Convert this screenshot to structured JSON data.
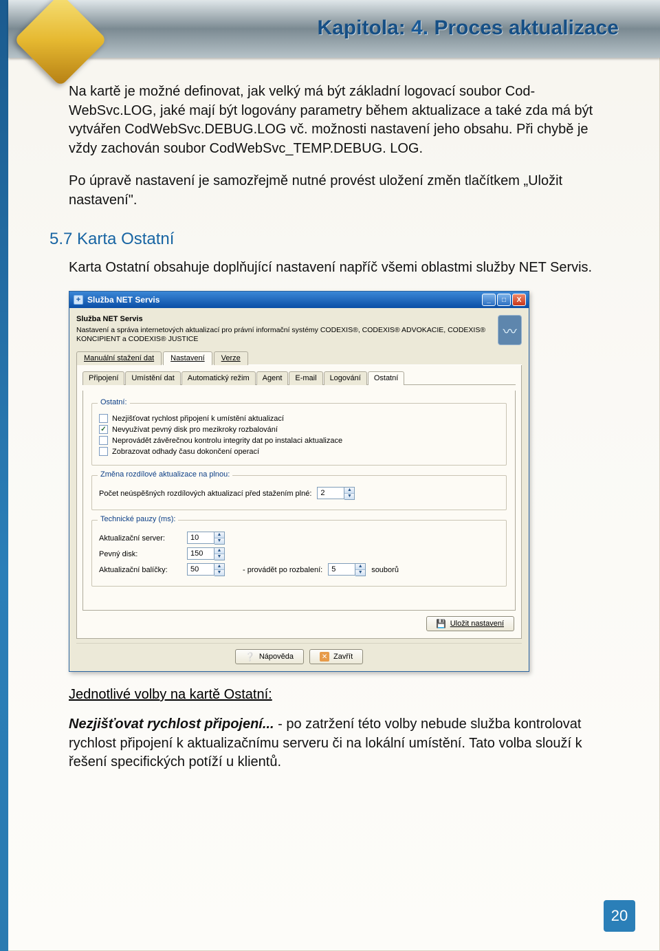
{
  "chapter": {
    "prefix": "Kapitola:",
    "num": "4.",
    "title": "Proces aktualizace"
  },
  "paragraphs": {
    "p1": "Na kartě je možné definovat, jak velký má být základní logovací soubor Cod-WebSvc.LOG, jaké mají být logovány parametry během aktualizace a také zda má být vytvářen CodWebSvc.DEBUG.LOG vč. možnosti nastavení jeho obsahu. Při chybě je vždy zachován soubor CodWebSvc_TEMP.DEBUG. LOG.",
    "p2": "Po úpravě nastavení je samozřejmě nutné provést uložení změn tlačítkem „Uložit nastavení\".",
    "section_head": "5.7 Karta Ostatní",
    "p3": "Karta Ostatní obsahuje doplňující nastavení napříč všemi oblastmi služby NET Servis.",
    "options_head": "Jednotlivé volby na kartě Ostatní:",
    "opt1_label": "Nezjišťovat rychlost připojení...",
    "opt1_text": " - po zatržení této volby nebude služba kontrolovat rychlost připojení k aktualizačnímu serveru či na lokální umístění. Tato volba slouží k řešení specifických potíží u klientů."
  },
  "page_number": "20",
  "win": {
    "title": "Služba NET Servis",
    "app_head_title": "Služba NET Servis",
    "app_head_desc": "Nastavení a správa internetových aktualizací pro právní informační systémy CODEXIS®, CODEXIS® ADVOKACIE, CODEXIS® KONCIPIENT a CODEXIS® JUSTICE",
    "main_tabs": [
      "Manuální stažení dat",
      "Nastavení",
      "Verze"
    ],
    "main_tabs_active": 1,
    "sub_tabs": [
      "Připojení",
      "Umístění dat",
      "Automatický režim",
      "Agent",
      "E-mail",
      "Logování",
      "Ostatní"
    ],
    "sub_tabs_active": 6,
    "group_ostatni": {
      "title": "Ostatní:",
      "checks": [
        {
          "label": "Nezjišťovat rychlost připojení k umístění aktualizací",
          "checked": false
        },
        {
          "label": "Nevyužívat pevný disk pro mezikroky rozbalování",
          "checked": true
        },
        {
          "label": "Neprovádět závěrečnou kontrolu integrity dat po instalaci aktualizace",
          "checked": false
        },
        {
          "label": "Zobrazovat odhady času dokončení operací",
          "checked": false
        }
      ]
    },
    "group_zmena": {
      "title": "Změna rozdílové aktualizace na plnou:",
      "row_label": "Počet neúspěšných rozdílových aktualizací před stažením plné:",
      "row_value": "2"
    },
    "group_pauzy": {
      "title": "Technické pauzy (ms):",
      "rows": [
        {
          "label": "Aktualizační server:",
          "value": "10"
        },
        {
          "label": "Pevný disk:",
          "value": "150"
        },
        {
          "label": "Aktualizační balíčky:",
          "value": "50",
          "extra_label": "- provádět po rozbalení:",
          "extra_value": "5",
          "suffix": "souborů"
        }
      ]
    },
    "buttons": {
      "save": "Uložit nastavení",
      "help": "Nápověda",
      "close": "Zavřít"
    },
    "tb": {
      "min": "_",
      "max": "□",
      "close": "X"
    }
  }
}
